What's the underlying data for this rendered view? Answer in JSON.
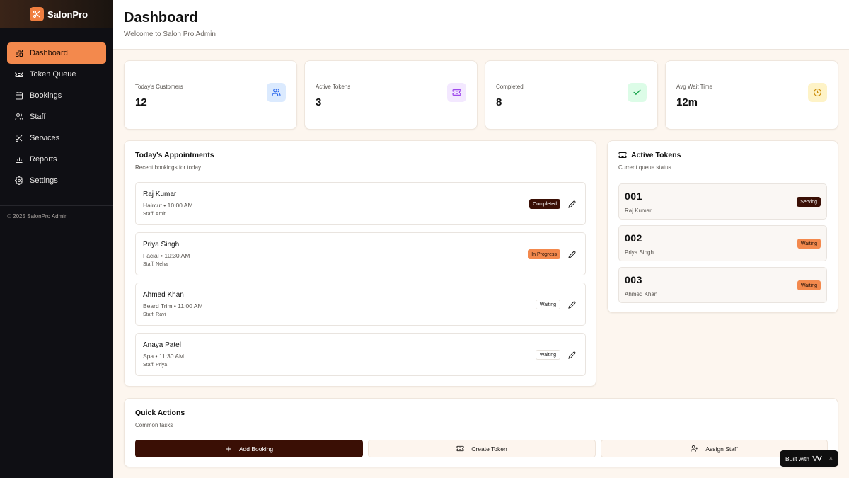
{
  "app": {
    "name": "SalonPro"
  },
  "sidebar": {
    "items": [
      {
        "label": "Dashboard",
        "icon": "grid-icon",
        "active": true
      },
      {
        "label": "Token Queue",
        "icon": "ticket-icon",
        "active": false
      },
      {
        "label": "Bookings",
        "icon": "calendar-icon",
        "active": false
      },
      {
        "label": "Staff",
        "icon": "users-icon",
        "active": false
      },
      {
        "label": "Services",
        "icon": "scissors-icon",
        "active": false
      },
      {
        "label": "Reports",
        "icon": "bar-chart-icon",
        "active": false
      },
      {
        "label": "Settings",
        "icon": "gear-icon",
        "active": false
      }
    ],
    "footer": "© 2025 SalonPro Admin"
  },
  "header": {
    "title": "Dashboard",
    "subtitle": "Welcome to Salon Pro Admin"
  },
  "stats": [
    {
      "label": "Today's Customers",
      "value": "12",
      "icon": "users-icon",
      "color": "#dbeafe"
    },
    {
      "label": "Active Tokens",
      "value": "3",
      "icon": "ticket-icon",
      "color": "#f3e8ff"
    },
    {
      "label": "Completed",
      "value": "8",
      "icon": "check-icon",
      "color": "#dcfce7"
    },
    {
      "label": "Avg Wait Time",
      "value": "12m",
      "icon": "clock-icon",
      "color": "#fef3c7"
    }
  ],
  "appointments": {
    "title": "Today's Appointments",
    "subtitle": "Recent bookings for today",
    "items": [
      {
        "name": "Raj Kumar",
        "detail": "Haircut • 10:00 AM",
        "staff": "Staff: Amit",
        "status": "Completed"
      },
      {
        "name": "Priya Singh",
        "detail": "Facial • 10:30 AM",
        "staff": "Staff: Neha",
        "status": "In Progress"
      },
      {
        "name": "Ahmed Khan",
        "detail": "Beard Trim • 11:00 AM",
        "staff": "Staff: Ravi",
        "status": "Waiting"
      },
      {
        "name": "Anaya Patel",
        "detail": "Spa • 11:30 AM",
        "staff": "Staff: Priya",
        "status": "Waiting"
      }
    ]
  },
  "tokens": {
    "title": "Active Tokens",
    "subtitle": "Current queue status",
    "items": [
      {
        "number": "001",
        "name": "Raj Kumar",
        "status": "Serving"
      },
      {
        "number": "002",
        "name": "Priya Singh",
        "status": "Waiting"
      },
      {
        "number": "003",
        "name": "Ahmed Khan",
        "status": "Waiting"
      }
    ]
  },
  "quick_actions": {
    "title": "Quick Actions",
    "subtitle": "Common tasks",
    "buttons": [
      {
        "label": "Add Booking",
        "icon": "plus-icon"
      },
      {
        "label": "Create Token",
        "icon": "ticket-icon"
      },
      {
        "label": "Assign Staff",
        "icon": "user-plus-icon"
      }
    ]
  },
  "built_with": {
    "label": "Built with",
    "close": "×"
  },
  "colors": {
    "accent": "#f3894d",
    "dark_brown": "#3a0f05",
    "sidebar_bg": "#0f0f14"
  }
}
